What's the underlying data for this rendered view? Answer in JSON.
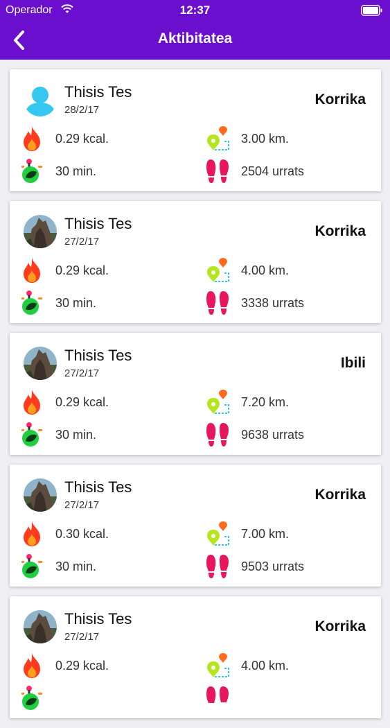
{
  "status_bar": {
    "carrier": "Operador",
    "time": "12:37"
  },
  "nav": {
    "title": "Aktibitatea",
    "back_icon": "chevron-left-icon"
  },
  "colors": {
    "brand": "#6a0fce",
    "flame": "#ff3b1f",
    "steps": "#e8175d",
    "map": "#b5e61d",
    "timer": "#1fcf3f"
  },
  "cards": [
    {
      "user": "Thisis Tes",
      "date": "28/2/17",
      "type": "Korrika",
      "kcal": "0.29 kcal.",
      "distance": "3.00 km.",
      "time": "30 min.",
      "steps": "2504 urrats",
      "avatar": "default-user-icon"
    },
    {
      "user": "Thisis Tes",
      "date": "27/2/17",
      "type": "Korrika",
      "kcal": "0.29 kcal.",
      "distance": "4.00 km.",
      "time": "30 min.",
      "steps": "3338 urrats",
      "avatar": "photo"
    },
    {
      "user": "Thisis Tes",
      "date": "27/2/17",
      "type": "Ibili",
      "kcal": "0.29 kcal.",
      "distance": "7.20 km.",
      "time": "30 min.",
      "steps": "9638 urrats",
      "avatar": "photo"
    },
    {
      "user": "Thisis Tes",
      "date": "27/2/17",
      "type": "Korrika",
      "kcal": "0.30 kcal.",
      "distance": "7.00 km.",
      "time": "30 min.",
      "steps": "9503 urrats",
      "avatar": "photo"
    },
    {
      "user": "Thisis Tes",
      "date": "27/2/17",
      "type": "Korrika",
      "kcal": "0.29 kcal.",
      "distance": "4.00 km.",
      "time": "",
      "steps": "",
      "avatar": "photo"
    }
  ]
}
